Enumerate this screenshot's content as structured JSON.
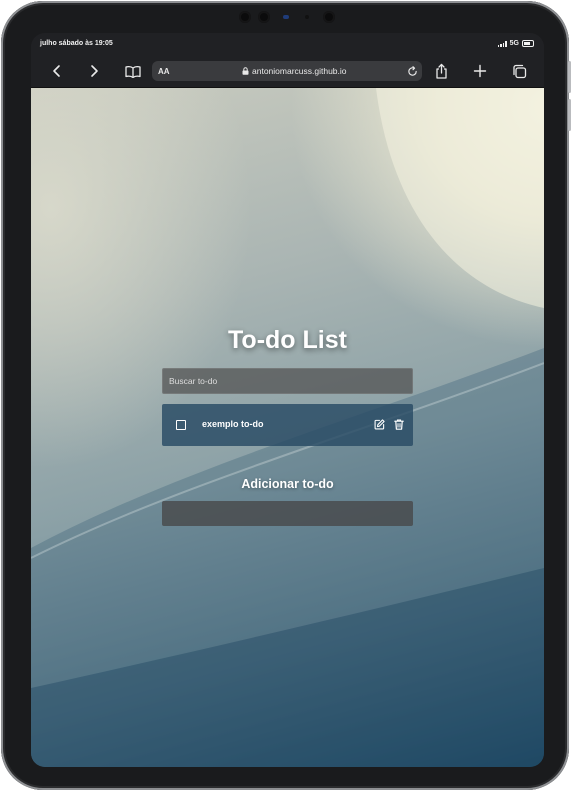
{
  "status": {
    "time": "julho sábado às 19:05",
    "network": "5G"
  },
  "browser": {
    "text_size_label": "AA",
    "url": "antoniomarcuss.github.io",
    "icons": [
      "chevron-left-icon",
      "chevron-right-icon",
      "book-icon",
      "lock-icon",
      "reload-icon",
      "share-icon",
      "plus-icon",
      "tabs-icon"
    ]
  },
  "app": {
    "title": "To-do List",
    "search_placeholder": "Buscar to-do",
    "todos": [
      {
        "text": "exemplo to-do",
        "done": false
      }
    ],
    "add_title": "Adicionar to-do",
    "add_value": ""
  }
}
